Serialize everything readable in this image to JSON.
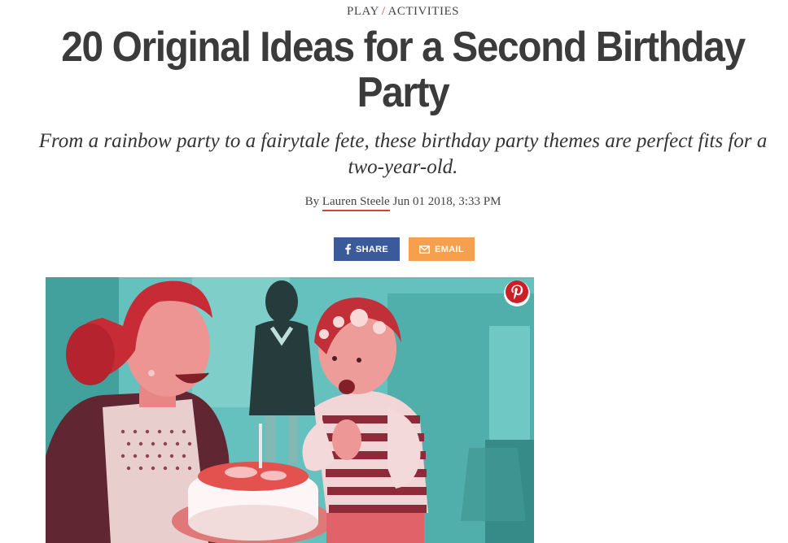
{
  "breadcrumb": {
    "section": "PLAY",
    "separator": "/",
    "subsection": "ACTIVITIES"
  },
  "article": {
    "title": "20 Original Ideas for a Second Birthday Party",
    "dek": "From a rainbow party to a fairytale fete, these birthday party themes are perfect fits for a two-year-old.",
    "byline_prefix": "By",
    "author": "Lauren Steele",
    "date": "Jun 01 2018, 3:33 PM"
  },
  "share": {
    "facebook_label": "SHARE",
    "facebook_icon": "facebook-icon",
    "email_label": "EMAIL",
    "email_icon": "envelope-icon"
  },
  "hero": {
    "pin_icon": "pinterest-icon"
  },
  "colors": {
    "accent": "#d0443b",
    "facebook": "#3b5a9a",
    "email": "#f6a04d",
    "duotone_teal": "#5fc9c3",
    "duotone_red": "#d9424c",
    "pinterest": "#cb1f27"
  }
}
